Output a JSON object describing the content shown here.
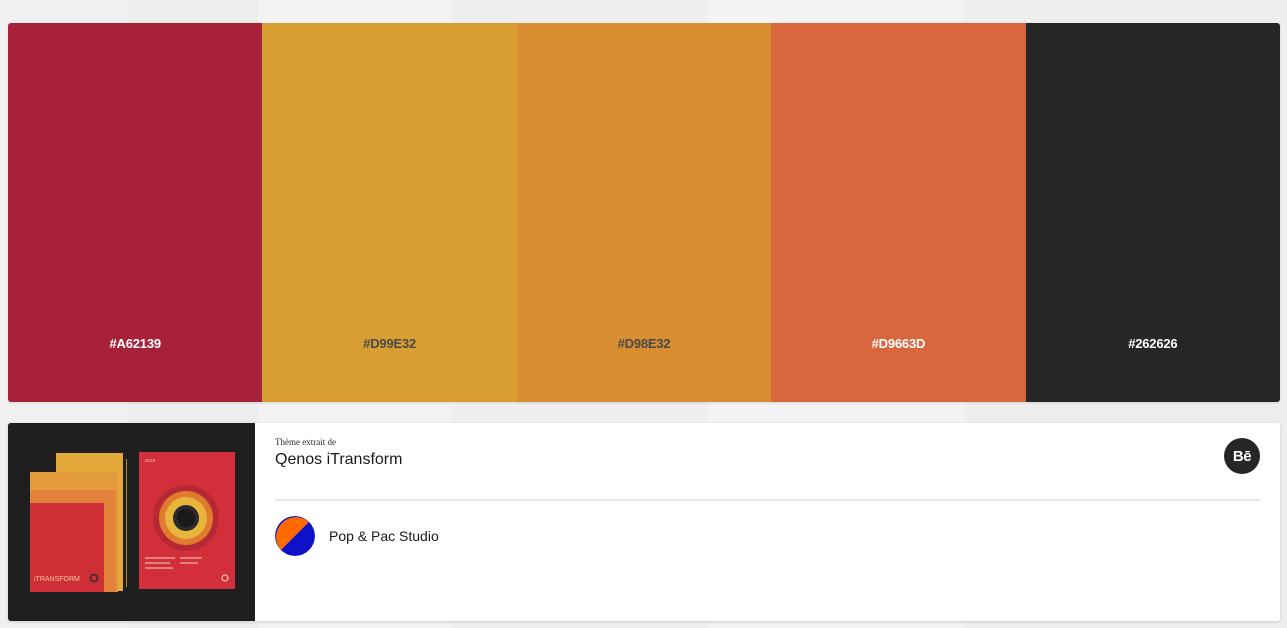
{
  "palette": {
    "swatches": [
      {
        "hex": "#A62139",
        "label": "#A62139",
        "text_color": "#ffffff"
      },
      {
        "hex": "#D99E32",
        "label": "#D99E32",
        "text_color": "#4a4a4a"
      },
      {
        "hex": "#D98E32",
        "label": "#D98E32",
        "text_color": "#4a4a4a"
      },
      {
        "hex": "#D9663D",
        "label": "#D9663D",
        "text_color": "#ffffff"
      },
      {
        "hex": "#262626",
        "label": "#262626",
        "text_color": "#ffffff"
      }
    ]
  },
  "source": {
    "extracted_label": "Thème extrait de",
    "project_title": "Qenos iTransform",
    "behance_icon": "behance-icon",
    "behance_text": "Bē",
    "author_name": "Pop & Pac Studio",
    "thumbnail_text": "iTRANSFORM",
    "thumbnail_year": "2019"
  }
}
